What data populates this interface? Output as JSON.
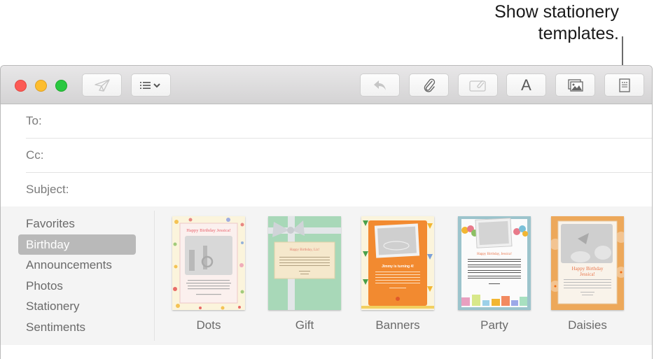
{
  "callout": {
    "line1": "Show stationery",
    "line2": "templates."
  },
  "window": {
    "traffic_lights": {
      "close": "close",
      "minimize": "minimize",
      "zoom": "zoom"
    },
    "toolbar": {
      "send": {
        "icon": "paper-plane-icon",
        "enabled": false
      },
      "header_fields": {
        "icon": "list-chevron-icon",
        "enabled": true
      },
      "reply": {
        "icon": "reply-arrow-icon",
        "enabled": false
      },
      "attach": {
        "icon": "paperclip-icon",
        "enabled": true
      },
      "markup": {
        "icon": "attachment-markup-icon",
        "enabled": false
      },
      "format": {
        "label": "A",
        "icon": "font-icon",
        "enabled": true
      },
      "photo_browser": {
        "icon": "photos-icon",
        "enabled": true
      },
      "stationery": {
        "icon": "stationery-icon",
        "enabled": true
      }
    },
    "fields": {
      "to_label": "To:",
      "to_value": "",
      "cc_label": "Cc:",
      "cc_value": "",
      "subject_label": "Subject:",
      "subject_value": ""
    },
    "stationery": {
      "categories": [
        {
          "label": "Favorites",
          "selected": false
        },
        {
          "label": "Birthday",
          "selected": true
        },
        {
          "label": "Announcements",
          "selected": false
        },
        {
          "label": "Photos",
          "selected": false
        },
        {
          "label": "Stationery",
          "selected": false
        },
        {
          "label": "Sentiments",
          "selected": false
        }
      ],
      "templates": [
        {
          "label": "Dots",
          "heading": "Happy Birthday Jessica!",
          "colors": {
            "bg": "#fbf4dc",
            "accent": "#e8606a"
          }
        },
        {
          "label": "Gift",
          "heading": "Happy Birthday, Liz!",
          "colors": {
            "bg": "#a8d8b8",
            "accent": "#e07a6a"
          }
        },
        {
          "label": "Banners",
          "heading": "Jimmy is turning 4!",
          "colors": {
            "bg": "#fbf4dc",
            "accent": "#f28a30"
          }
        },
        {
          "label": "Party",
          "heading": "Happy Birthday Jessica!",
          "colors": {
            "bg": "#9cc4cc",
            "accent": "#e8744a"
          }
        },
        {
          "label": "Daisies",
          "heading": "Happy Birthday Jessica!",
          "colors": {
            "bg": "#eda85a",
            "accent": "#e8744a"
          }
        }
      ]
    }
  }
}
